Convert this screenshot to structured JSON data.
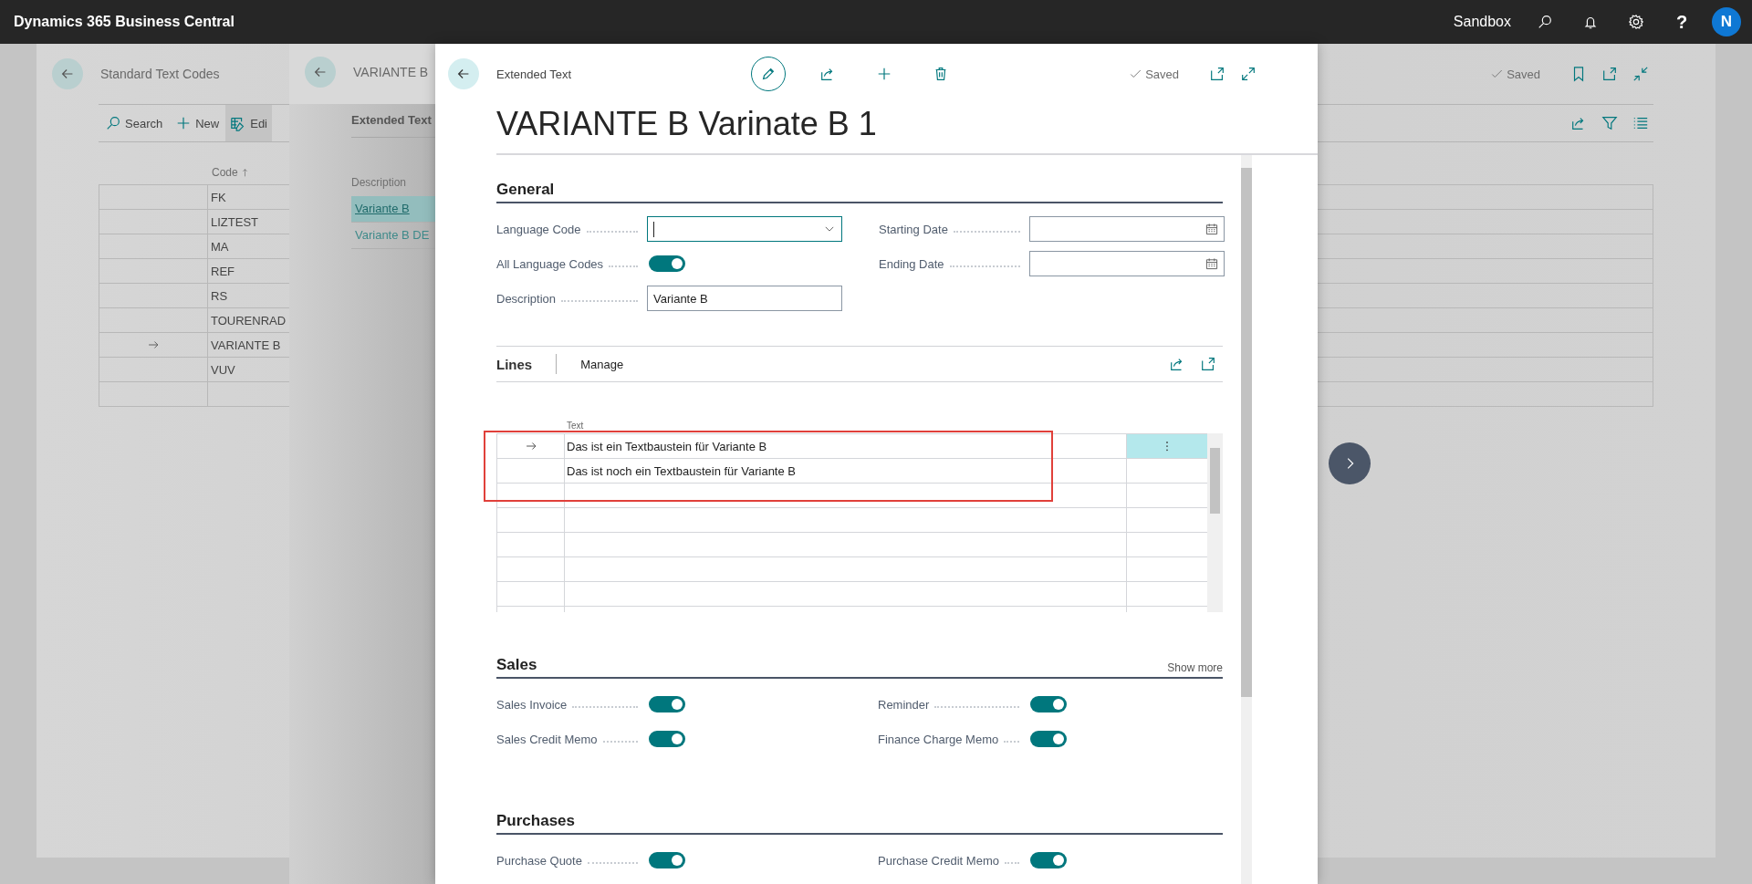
{
  "app_bar": {
    "title": "Dynamics 365 Business Central",
    "environment": "Sandbox",
    "help": "?",
    "avatar_initial": "N"
  },
  "list_page": {
    "title": "Standard Text Codes",
    "status": "Saved",
    "actions": [
      {
        "label": "Search"
      },
      {
        "label": "New"
      },
      {
        "label": "Edi"
      }
    ],
    "column": "Code",
    "rows": [
      {
        "code": "FK",
        "current": false
      },
      {
        "code": "LIZTEST",
        "current": false
      },
      {
        "code": "MA",
        "current": false
      },
      {
        "code": "REF",
        "current": false
      },
      {
        "code": "RS",
        "current": false
      },
      {
        "code": "TOURENRAD",
        "current": false
      },
      {
        "code": "VARIANTE B",
        "current": true
      },
      {
        "code": "VUV",
        "current": false
      }
    ]
  },
  "card_page": {
    "title": "VARIANTE B",
    "part_title": "Extended Text",
    "column": "Description",
    "rows": [
      {
        "text": "Variante B",
        "selected": true
      },
      {
        "text": "Variante B DE",
        "selected": false
      }
    ]
  },
  "dialog": {
    "breadcrumb": "Extended Text",
    "title": "VARIANTE B Varinate B 1",
    "status": "Saved",
    "general": {
      "title": "General",
      "columns": [
        [
          {
            "label": "Language Code",
            "kind": "select",
            "focused": true
          },
          {
            "label": "All Language Codes",
            "kind": "toggle",
            "on": true
          },
          {
            "label": "Description",
            "kind": "text",
            "value": "Variante B"
          }
        ],
        [
          {
            "label": "Starting Date",
            "kind": "date"
          },
          {
            "label": "Ending Date",
            "kind": "date"
          }
        ]
      ]
    },
    "lines": {
      "title": "Lines",
      "action": "Manage",
      "column": "Text",
      "rows": [
        {
          "text": "Das ist ein Textbaustein für Variante B",
          "current": true
        },
        {
          "text": "Das ist noch ein Textbaustein für Variante B",
          "current": false
        }
      ]
    },
    "sales": {
      "title": "Sales",
      "more": "Show more",
      "columns": [
        [
          {
            "label": "Sales Invoice",
            "kind": "toggle",
            "on": true
          },
          {
            "label": "Sales Credit Memo",
            "kind": "toggle",
            "on": true
          }
        ],
        [
          {
            "label": "Reminder",
            "kind": "toggle",
            "on": true
          },
          {
            "label": "Finance Charge Memo",
            "kind": "toggle",
            "on": true
          }
        ]
      ]
    },
    "purchases": {
      "title": "Purchases",
      "columns": [
        [
          {
            "label": "Purchase Quote",
            "kind": "toggle",
            "on": true
          }
        ],
        [
          {
            "label": "Purchase Credit Memo",
            "kind": "toggle",
            "on": true
          }
        ]
      ]
    }
  }
}
